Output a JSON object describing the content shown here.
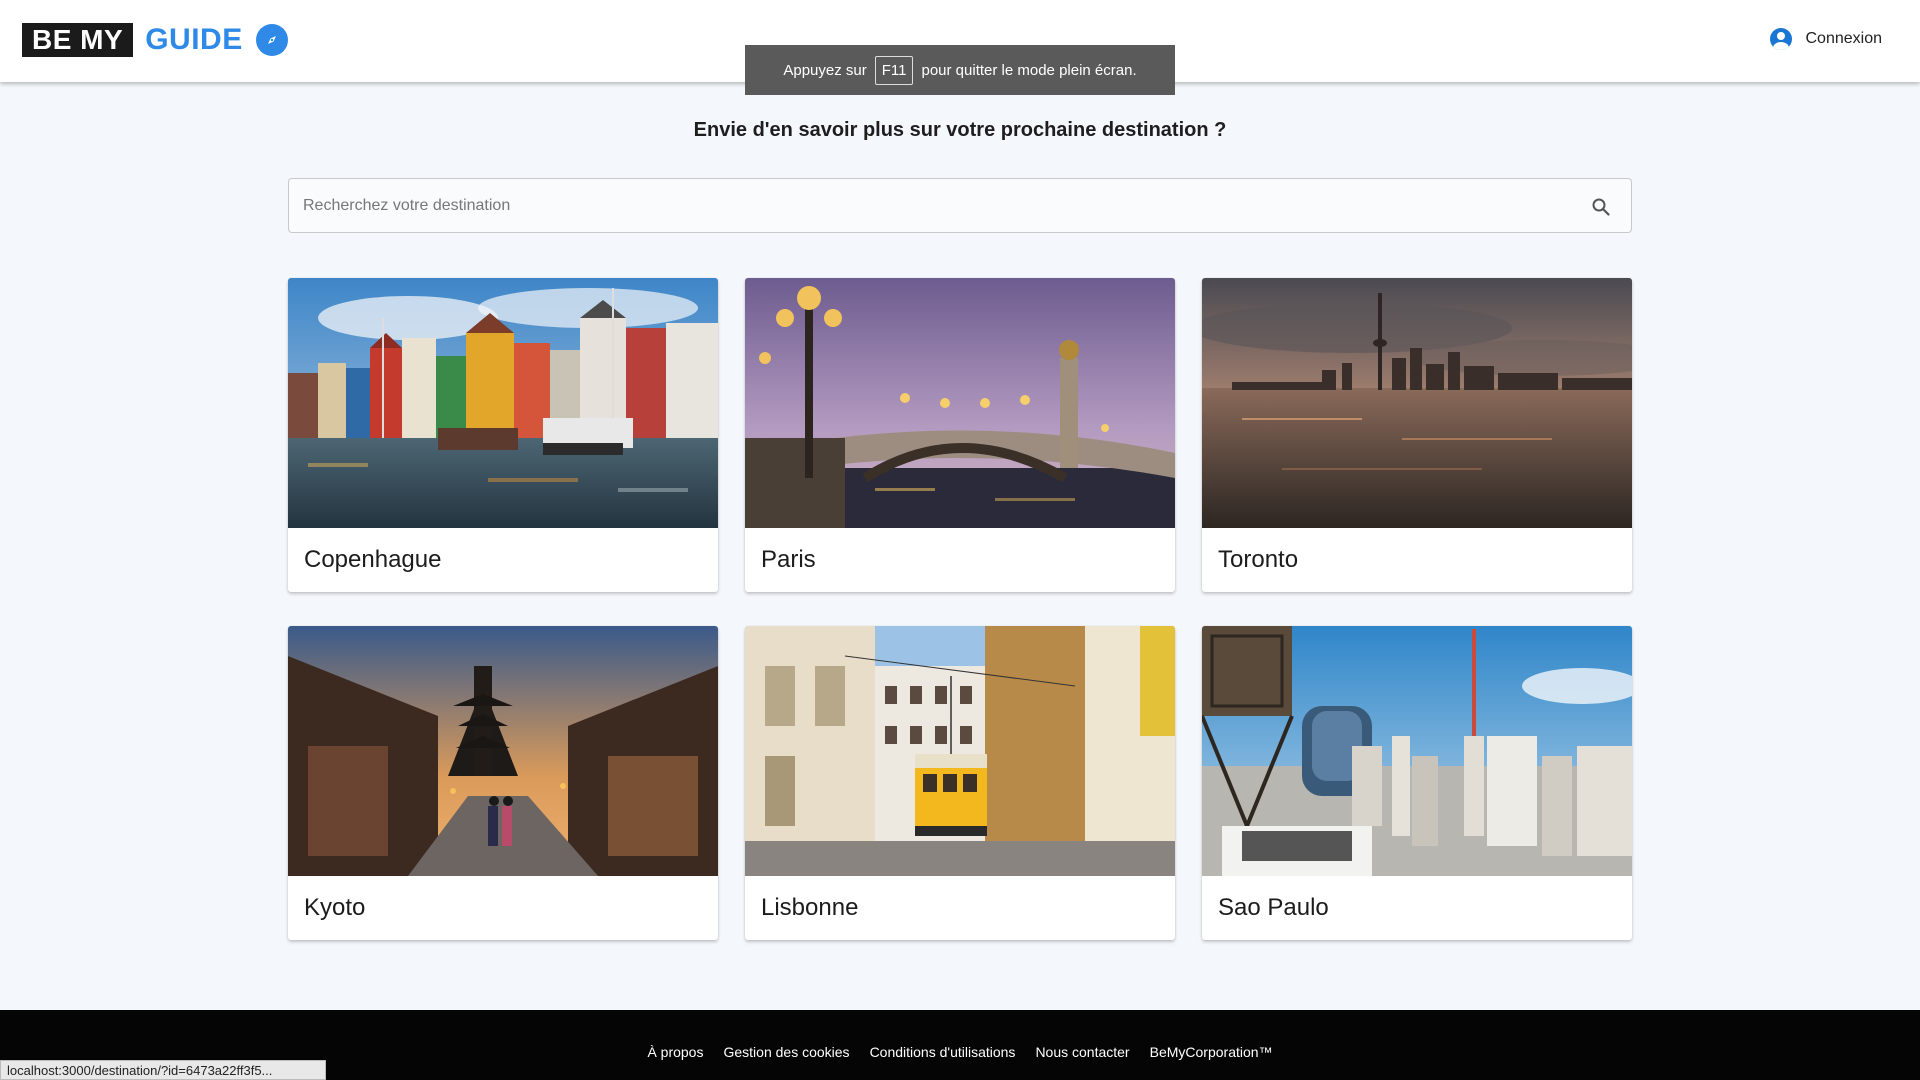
{
  "header": {
    "logo_part1": "BE MY",
    "logo_part2": "GUIDE",
    "login_label": "Connexion",
    "accent": "#2e8ae6"
  },
  "toast": {
    "before": "Appuyez sur",
    "key": "F11",
    "after": "pour quitter le mode plein écran."
  },
  "main": {
    "heading": "Envie d'en savoir plus sur votre prochaine destination ?",
    "search_placeholder": "Recherchez votre destination",
    "cards": [
      {
        "title": "Copenhague",
        "image": "copenhagen-harbor"
      },
      {
        "title": "Paris",
        "image": "paris-bridge-dusk"
      },
      {
        "title": "Toronto",
        "image": "toronto-skyline-sunset"
      },
      {
        "title": "Kyoto",
        "image": "kyoto-pagoda-street"
      },
      {
        "title": "Lisbonne",
        "image": "lisbon-yellow-tram"
      },
      {
        "title": "Sao Paulo",
        "image": "sao-paulo-cityscape"
      }
    ]
  },
  "footer": {
    "links": [
      "À propos",
      "Gestion des cookies",
      "Conditions d'utilisations",
      "Nous contacter",
      "BeMyCorporation™"
    ]
  },
  "status_bar": "localhost:3000/destination/?id=6473a22ff3f5..."
}
